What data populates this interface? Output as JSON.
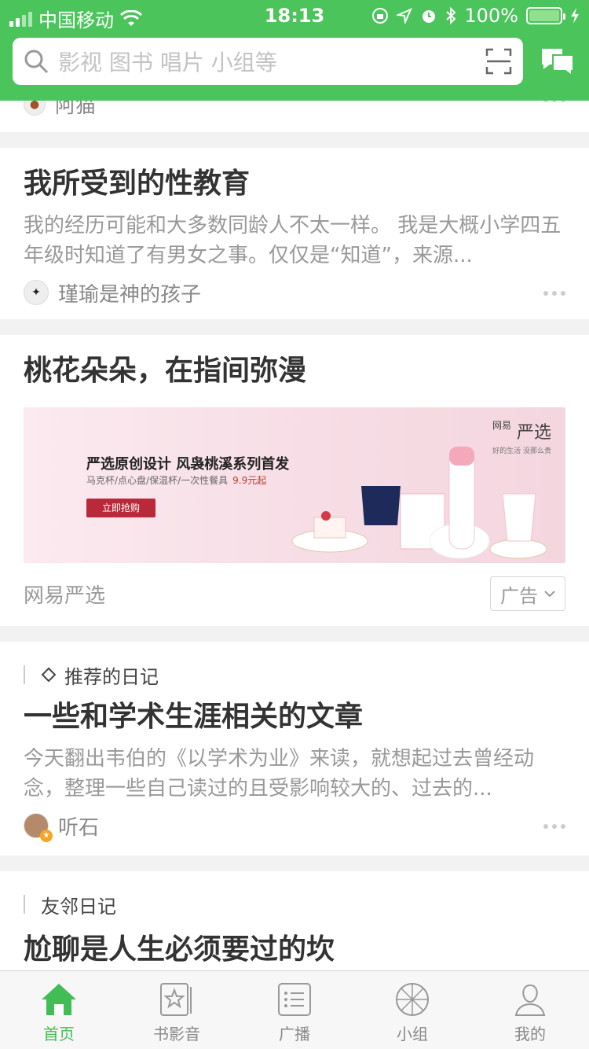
{
  "status_bar": {
    "carrier": "中国移动",
    "time": "18:13",
    "battery": "100%"
  },
  "search": {
    "placeholder": "影视 图书 唱片 小组等"
  },
  "partial_card": {
    "author": "阿猫"
  },
  "cards": [
    {
      "title": "我所受到的性教育",
      "excerpt": "我的经历可能和大多数同龄人不太一样。 我是大概小学四五年级时知道了有男女之事。仅仅是“知道”，来源...",
      "author": "瑾瑜是神的孩子"
    },
    {
      "title": "一些和学术生涯相关的文章",
      "tag": "推荐的日记",
      "excerpt": "今天翻出韦伯的《以学术为业》来读，就想起过去曾经动念，整理一些自己读过的且受影响较大的、过去的...",
      "author": "听石"
    },
    {
      "title": "尬聊是人生必须要过的坎",
      "tag": "友邻日记"
    }
  ],
  "ad": {
    "title": "桃花朵朵，在指间弥漫",
    "banner_title": "严选原创设计 风袅桃溪系列首发",
    "banner_sub": "马克杯/点心盘/保温杯/一次性餐具",
    "banner_price": "9.9元起",
    "banner_button": "立即抢购",
    "brand": "严选",
    "brand_prefix": "网易",
    "brand_slogan": "好的生活 没那么贵",
    "source": "网易严选",
    "label": "广告"
  },
  "tabs": [
    {
      "label": "首页",
      "icon": "home-icon",
      "active": true
    },
    {
      "label": "书影音",
      "icon": "book-movie-icon"
    },
    {
      "label": "广播",
      "icon": "broadcast-icon"
    },
    {
      "label": "小组",
      "icon": "group-icon"
    },
    {
      "label": "我的",
      "icon": "profile-icon"
    }
  ],
  "colors": {
    "brand_green": "#4bc55b",
    "active_tab": "#42bd56"
  }
}
